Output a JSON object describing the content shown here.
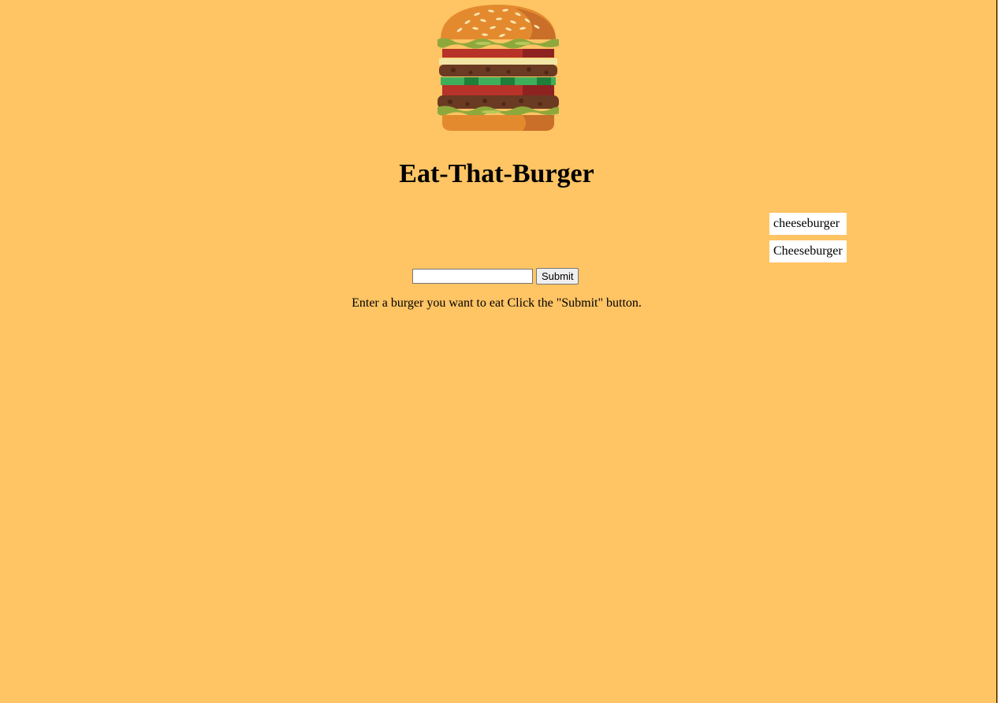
{
  "app": {
    "title": "Eat-That-Burger"
  },
  "logo": {
    "icon": "hamburger-icon",
    "colors": {
      "bun": "#E48A2E",
      "bun_shadow": "#C96F2A",
      "lettuce": "#8FA83C",
      "tomato": "#B73228",
      "patty": "#6A3A22",
      "cheese": "#F1E6A6",
      "pickle": "#2E9B4A"
    }
  },
  "burgers": [
    {
      "name": "cheeseburger"
    },
    {
      "name": "Cheeseburger"
    }
  ],
  "form": {
    "input_value": "",
    "input_placeholder": "",
    "submit_label": "Submit"
  },
  "instructions": "Enter a burger you want to eat Click the \"Submit\" button.",
  "theme": {
    "background": "#FFC464",
    "list_item_background": "#FFFFFF"
  }
}
